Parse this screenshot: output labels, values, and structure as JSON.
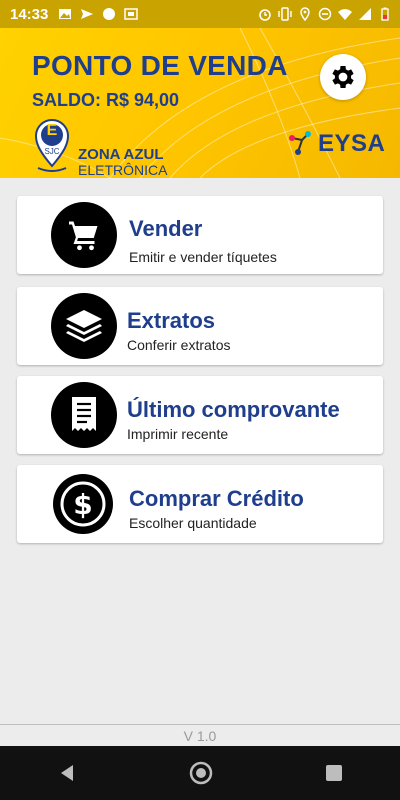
{
  "status_bar": {
    "time": "14:33",
    "icons_left": [
      "image-icon",
      "send-icon",
      "chat-icon",
      "cast-icon"
    ],
    "icons_right": [
      "alarm-icon",
      "vibrate-icon",
      "location-icon",
      "dnd-icon",
      "wifi-icon",
      "signal-icon",
      "battery-icon"
    ]
  },
  "header": {
    "title": "PONTO DE VENDA",
    "balance": "SALDO: R$ 94,00",
    "zona_badge": "E",
    "zona_badge_sub": "SJC",
    "zona_line1": "ZONA AZUL",
    "zona_line2": "ELETRÔNICA",
    "partner_logo": "EYSA",
    "colors": {
      "brand_blue": "#1f3e8c",
      "yellow": "#ffd200"
    }
  },
  "menu": [
    {
      "label": "Vender",
      "subtitle": "Emitir e vender tíquetes",
      "icon": "cart-icon"
    },
    {
      "label": "Extratos",
      "subtitle": "Conferir extratos",
      "icon": "layers-icon"
    },
    {
      "label": "Último comprovante",
      "subtitle": "Imprimir recente",
      "icon": "receipt-icon"
    },
    {
      "label": "Comprar Crédito",
      "subtitle": "Escolher quantidade",
      "icon": "dollar-icon"
    }
  ],
  "footer": {
    "version": "V 1.0"
  }
}
